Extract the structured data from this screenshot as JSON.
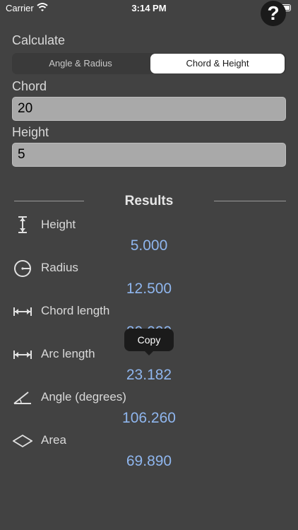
{
  "status_bar": {
    "carrier": "Carrier",
    "time": "3:14 PM"
  },
  "help_button": {
    "label": "?"
  },
  "calculate": {
    "label": "Calculate",
    "segments": [
      {
        "label": "Angle & Radius",
        "selected": false
      },
      {
        "label": "Chord & Height",
        "selected": true
      }
    ]
  },
  "inputs": {
    "chord": {
      "label": "Chord",
      "value": "20"
    },
    "height": {
      "label": "Height",
      "value": "5"
    }
  },
  "results": {
    "title": "Results",
    "items": [
      {
        "label": "Height",
        "value": "5.000",
        "icon": "height-icon"
      },
      {
        "label": "Radius",
        "value": "12.500",
        "icon": "radius-icon"
      },
      {
        "label": "Chord length",
        "value": "20.000",
        "icon": "chord-length-icon"
      },
      {
        "label": "Arc length",
        "value": "23.182",
        "icon": "arc-length-icon"
      },
      {
        "label": "Angle (degrees)",
        "value": "106.260",
        "icon": "angle-icon"
      },
      {
        "label": "Area",
        "value": "69.890",
        "icon": "area-icon"
      }
    ]
  },
  "tooltip": {
    "label": "Copy"
  },
  "colors": {
    "background": "#424242",
    "accent_value": "#8fb6ee",
    "field_bg": "#a9a9a9",
    "selected_segment": "#ffffff"
  }
}
